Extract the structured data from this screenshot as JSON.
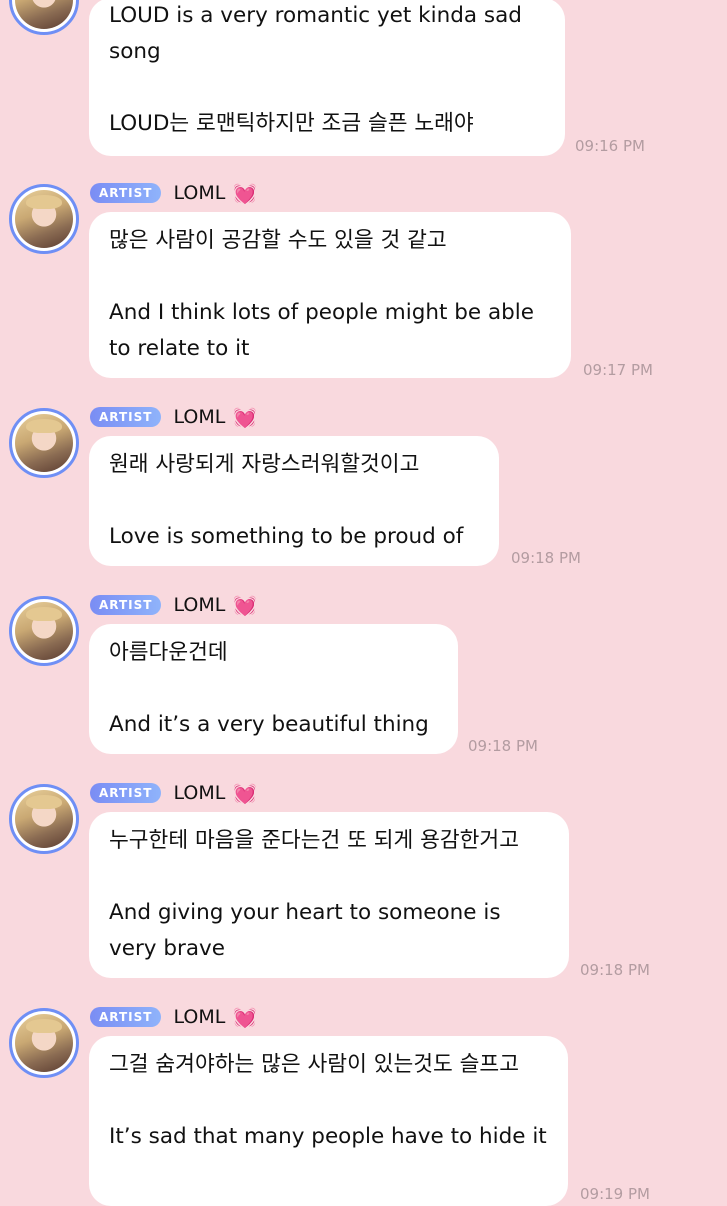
{
  "messages": [
    {
      "show_header": false,
      "text_ko": "",
      "text_en": "LOUD is a very romantic yet kinda sad song\n\nLOUD는 로맨틱하지만 조금 슬픈 노래야",
      "time": "09:16 PM"
    },
    {
      "show_header": true,
      "badge": "ARTIST",
      "name": "LOML",
      "heart": "💓",
      "text": "많은 사람이 공감할 수도 있을 것 같고\n\nAnd I think lots of people might be able to relate to it",
      "time": "09:17 PM"
    },
    {
      "show_header": true,
      "badge": "ARTIST",
      "name": "LOML",
      "heart": "💓",
      "text": "원래 사랑되게 자랑스러워할것이고\n\nLove is something to be proud of",
      "time": "09:18 PM"
    },
    {
      "show_header": true,
      "badge": "ARTIST",
      "name": "LOML",
      "heart": "💓",
      "text": "아름다운건데\n\nAnd it’s a very beautiful thing",
      "time": "09:18 PM"
    },
    {
      "show_header": true,
      "badge": "ARTIST",
      "name": "LOML",
      "heart": "💓",
      "text": "누구한테 마음을 준다는건 또 되게 용감한거고\n\nAnd giving your heart to someone is very brave",
      "time": "09:18 PM"
    },
    {
      "show_header": true,
      "badge": "ARTIST",
      "name": "LOML",
      "heart": "💓",
      "text": "그걸 숨겨야하는 많은 사람이 있는것도 슬프고\n\nIt’s sad that many people have to hide it",
      "time": "09:19 PM"
    }
  ]
}
